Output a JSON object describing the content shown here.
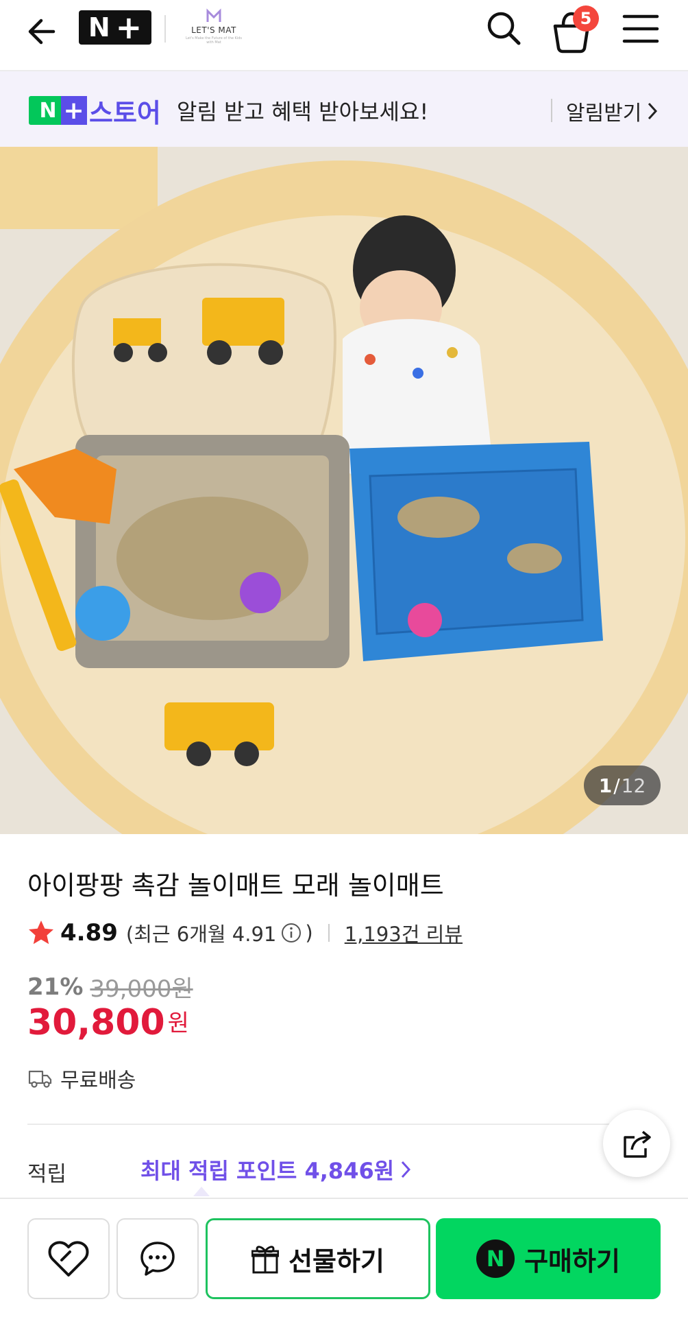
{
  "header": {
    "brand_badge_n": "N",
    "brand_badge_plus": "+",
    "store_logo_text": "LET'S MAT",
    "store_logo_sub": "Let's Make the Future of the Kids with Mat",
    "cart_count": "5"
  },
  "promo": {
    "badge_n": "N",
    "badge_plus": "+",
    "store_label": "스토어",
    "message": "알림 받고 혜택 받아보세요!",
    "cta_label": "알림받기"
  },
  "gallery": {
    "current": "1",
    "separator": "/",
    "total": "12"
  },
  "product": {
    "title": "아이팡팡 촉감 놀이매트 모래 놀이매트",
    "rating": "4.89",
    "recent_prefix": "(최근 6개월 4.91",
    "recent_suffix": ")",
    "review_link": "1,193건 리뷰",
    "discount_rate": "21%",
    "original_price": "39,000원",
    "sale_price": "30,800",
    "currency": "원",
    "shipping": "무료배송"
  },
  "benefits": {
    "points_label": "적립",
    "points_value": "최대 적립 포인트 4,846원"
  },
  "actions": {
    "gift_label": "선물하기",
    "buy_label": "구매하기",
    "buy_badge": "N"
  },
  "colors": {
    "accent_purple": "#5b4ee8",
    "naver_green": "#02d660",
    "price_red": "#e11a3b",
    "badge_red": "#f4463c"
  },
  "icons": [
    "back-arrow-icon",
    "search-icon",
    "cart-icon",
    "hamburger-menu-icon",
    "chevron-right-icon",
    "star-icon",
    "info-icon",
    "delivery-truck-icon",
    "share-icon",
    "heart-icon",
    "chat-bubble-icon",
    "gift-box-icon"
  ]
}
